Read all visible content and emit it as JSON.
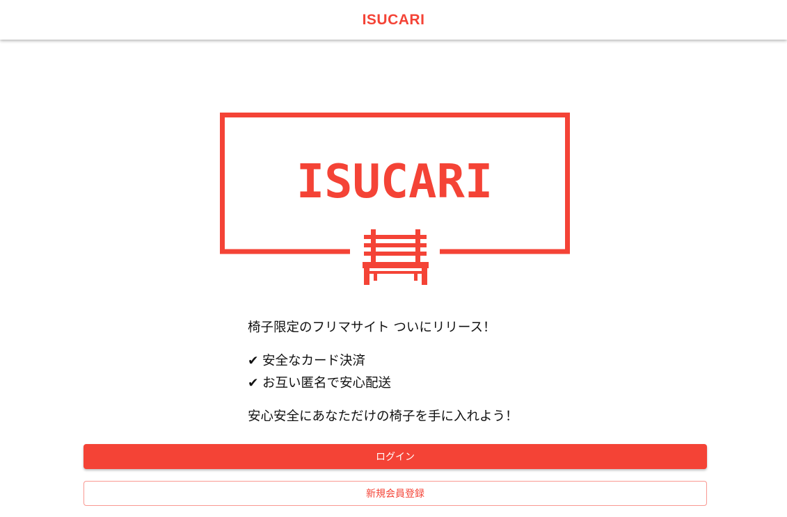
{
  "header": {
    "title": "ISUCARI"
  },
  "hero": {
    "logo_text": "ISUCARI",
    "logo_icon": "bench-icon"
  },
  "copy": {
    "lead": "椅子限定のフリマサイト ついにリリース！",
    "features": [
      {
        "check": "✔",
        "text": "安全なカード決済"
      },
      {
        "check": "✔",
        "text": "お互い匿名で安心配送"
      }
    ],
    "closing": "安心安全にあなただけの椅子を手に入れよう！"
  },
  "actions": {
    "login_label": "ログイン",
    "register_label": "新規会員登録"
  },
  "colors": {
    "accent": "#f44336",
    "text": "#111111",
    "background": "#ffffff"
  }
}
